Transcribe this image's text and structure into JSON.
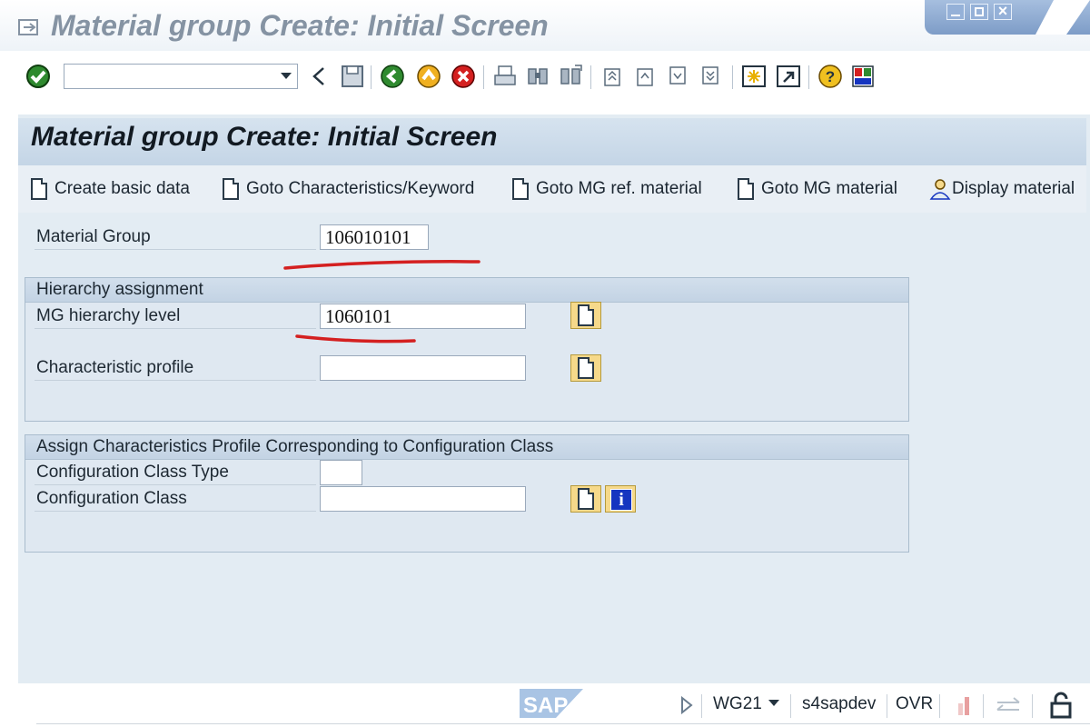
{
  "window": {
    "title": "Material group  Create: Initial Screen"
  },
  "toolbar": {
    "command_field": {
      "value": ""
    },
    "icons": [
      "enter-check-icon",
      "command-dropdown-icon",
      "back-triangle-icon",
      "save-icon",
      "back-icon",
      "exit-icon",
      "cancel-icon",
      "print-icon",
      "find-icon",
      "find-next-icon",
      "first-page-icon",
      "previous-page-icon",
      "next-page-icon",
      "last-page-icon",
      "create-session-icon",
      "shortcut-icon",
      "help-icon",
      "customize-layout-icon"
    ]
  },
  "screen": {
    "title": "Material group  Create: Initial Screen"
  },
  "app_toolbar": {
    "buttons": [
      {
        "label": "Create basic data",
        "icon": "document-icon"
      },
      {
        "label": "Goto Characteristics/Keyword",
        "icon": "document-icon"
      },
      {
        "label": "Goto MG ref. material",
        "icon": "document-icon"
      },
      {
        "label": "Goto MG material",
        "icon": "document-icon"
      },
      {
        "label": "Display material",
        "icon": "person-icon"
      }
    ]
  },
  "form": {
    "material_group": {
      "label": "Material Group",
      "value": "106010101"
    },
    "hierarchy_group": {
      "title": "Hierarchy assignment",
      "mg_hierarchy_level": {
        "label": "MG hierarchy level",
        "value": "1060101"
      },
      "characteristic_profile": {
        "label": "Characteristic profile",
        "value": ""
      }
    },
    "config_group": {
      "title": "Assign Characteristics Profile Corresponding to Configuration Class",
      "config_class_type": {
        "label": "Configuration Class Type",
        "value": ""
      },
      "config_class": {
        "label": "Configuration Class",
        "value": ""
      }
    }
  },
  "statusbar": {
    "logo": "SAP",
    "transaction": "WG21",
    "system": "s4sapdev",
    "mode": "OVR"
  },
  "colors": {
    "annotation_red": "#d42020",
    "main_bg": "#e3ecf3",
    "title_gray": "#8593a3"
  }
}
